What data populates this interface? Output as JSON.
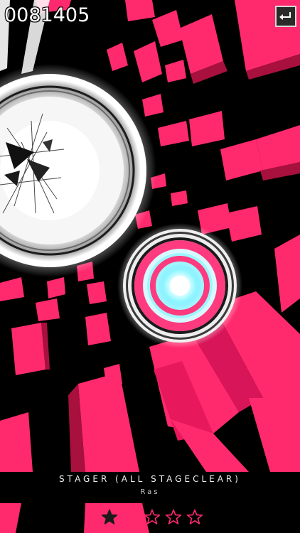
{
  "hud": {
    "score": "0081405"
  },
  "song": {
    "title": "STAGER (ALL STAGECLEAR)",
    "artist": "Ras"
  },
  "difficulty": {
    "filled": 1,
    "total": 5
  },
  "icons": {
    "back": "return-arrow-icon",
    "star": "star-icon"
  },
  "colors": {
    "background": "#000000",
    "block": "#ff2a6d",
    "block_dark": "#c0134a",
    "target_ring": "#ff3a7e",
    "target_glow": "#8ef6ff",
    "white_orb": "#ffffff"
  }
}
